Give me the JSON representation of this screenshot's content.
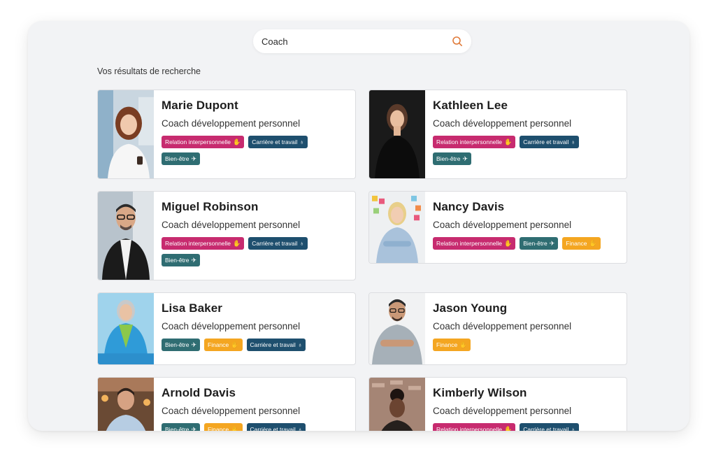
{
  "search": {
    "value": "Coach",
    "icon": "search-icon"
  },
  "results_title": "Vos résultats de recherche",
  "colors": {
    "relation": "#c72b6f",
    "carriere": "#1e4f6e",
    "bien_etre": "#2f6d72",
    "finance": "#f4a621",
    "search_icon": "#e07b3a"
  },
  "tag_labels": {
    "relation": "Relation interpersonnelle",
    "carriere": "Carrière et travail",
    "bien_etre": "Bien-être",
    "finance": "Finance"
  },
  "coaches": [
    {
      "name": "Marie Dupont",
      "role": "Coach développement personnel",
      "tags": [
        "relation",
        "carriere",
        "bien_etre"
      ]
    },
    {
      "name": "Kathleen Lee",
      "role": "Coach développement personnel",
      "tags": [
        "relation",
        "carriere",
        "bien_etre"
      ]
    },
    {
      "name": "Miguel Robinson",
      "role": "Coach développement personnel",
      "tags": [
        "relation",
        "carriere",
        "bien_etre"
      ]
    },
    {
      "name": "Nancy Davis",
      "role": "Coach développement personnel",
      "tags": [
        "relation",
        "bien_etre",
        "finance"
      ]
    },
    {
      "name": "Lisa Baker",
      "role": "Coach développement personnel",
      "tags": [
        "bien_etre",
        "finance",
        "carriere"
      ]
    },
    {
      "name": "Jason Young",
      "role": "Coach développement personnel",
      "tags": [
        "finance"
      ]
    },
    {
      "name": "Arnold Davis",
      "role": "Coach développement personnel",
      "tags": [
        "bien_etre",
        "finance",
        "carriere"
      ]
    },
    {
      "name": "Kimberly Wilson",
      "role": "Coach développement personnel",
      "tags": [
        "relation",
        "carriere"
      ]
    }
  ]
}
